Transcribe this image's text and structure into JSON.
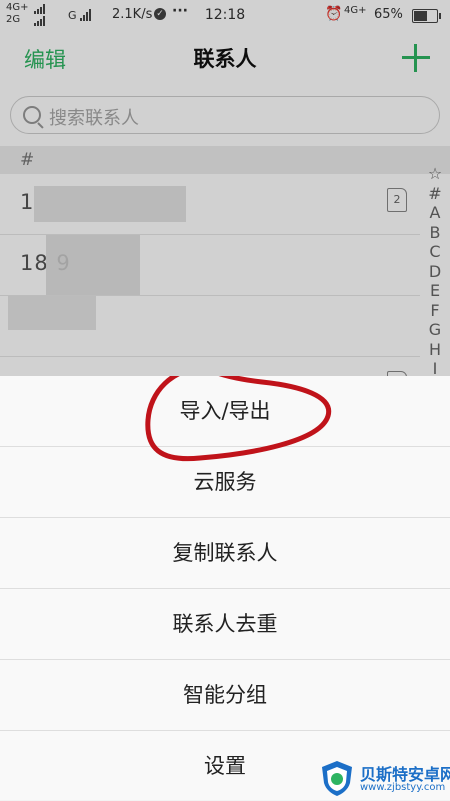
{
  "status_bar": {
    "network_top": "4G+",
    "network_bottom": "2G",
    "network_g": "G",
    "speed": "2.1K/s",
    "dots": "···",
    "time": "12:18",
    "network_right": "4G+",
    "battery": "65%",
    "battery_level": 0.65
  },
  "header": {
    "edit_label": "编辑",
    "title": "联系人"
  },
  "search": {
    "placeholder": "搜索联系人"
  },
  "list": {
    "section_header": "#",
    "contacts": [
      {
        "name": "1",
        "sim": "2"
      },
      {
        "name": "18          9"
      },
      {
        "name": ""
      },
      {
        "name": ""
      }
    ]
  },
  "index_bar": [
    "☆",
    "#",
    "A",
    "B",
    "C",
    "D",
    "E",
    "F",
    "G",
    "H",
    "I"
  ],
  "sheet": {
    "items": [
      "导入/导出",
      "云服务",
      "复制联系人",
      "联系人去重",
      "智能分组",
      "设置"
    ]
  },
  "watermark": {
    "title": "贝斯特安卓网",
    "url": "www.zjbstyy.com"
  },
  "colors": {
    "accent": "#2eb462",
    "annotation": "#c0131a"
  }
}
